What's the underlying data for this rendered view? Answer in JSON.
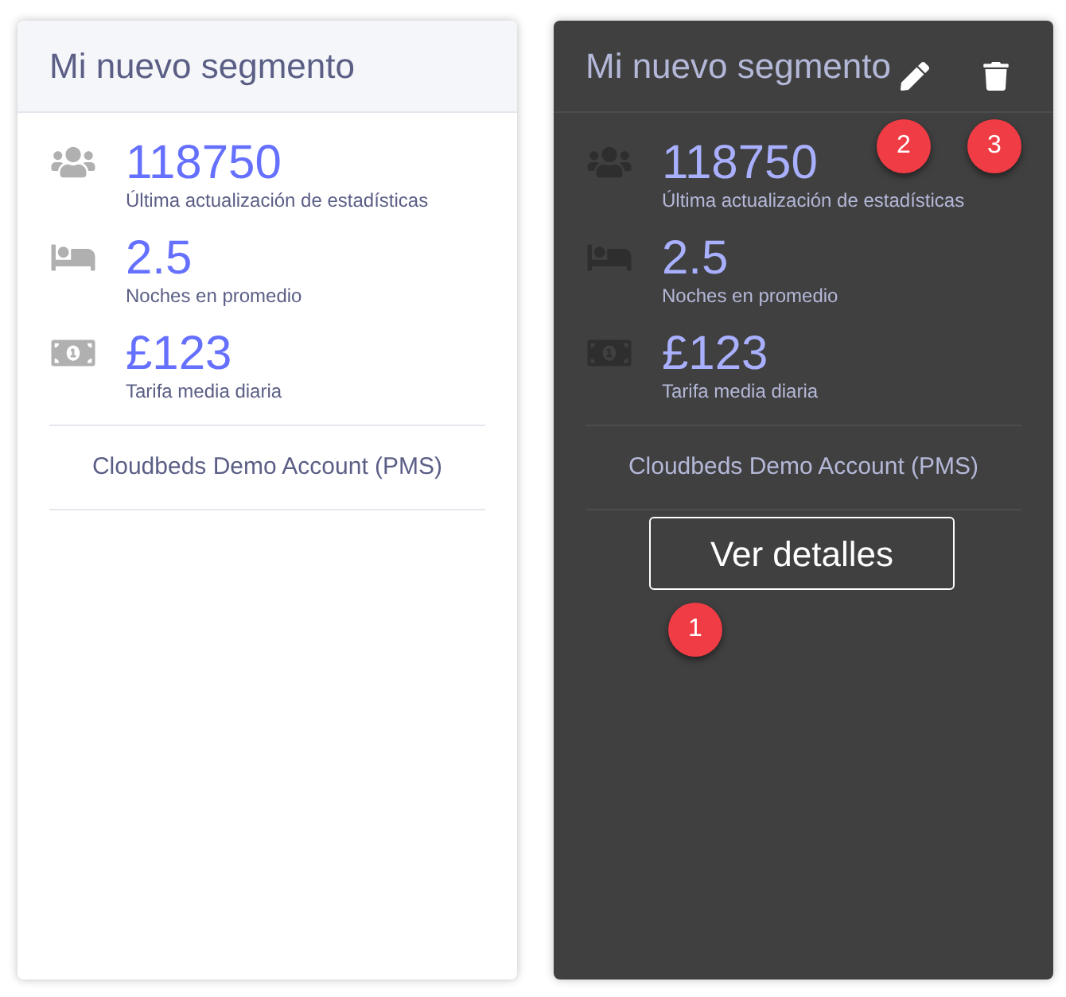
{
  "cards": [
    {
      "title": "Mi nuevo segmento",
      "hovered": false,
      "stats": [
        {
          "kind": "guests",
          "value": "118750",
          "label": "Última actualización de estadísticas"
        },
        {
          "kind": "nights",
          "value": "2.5",
          "label": "Noches en promedio"
        },
        {
          "kind": "rate",
          "value": "£123",
          "label": "Tarifa media diaria"
        }
      ],
      "account": "Cloudbeds Demo Account (PMS)"
    },
    {
      "title": "Mi nuevo segmento",
      "hovered": true,
      "stats": [
        {
          "kind": "guests",
          "value": "118750",
          "label": "Última actualización de estadísticas"
        },
        {
          "kind": "nights",
          "value": "2.5",
          "label": "Noches en promedio"
        },
        {
          "kind": "rate",
          "value": "£123",
          "label": "Tarifa media diaria"
        }
      ],
      "account": "Cloudbeds Demo Account (PMS)",
      "details_button": "Ver detalles",
      "callouts": [
        {
          "label": "1"
        },
        {
          "label": "2"
        },
        {
          "label": "3"
        }
      ]
    }
  ]
}
